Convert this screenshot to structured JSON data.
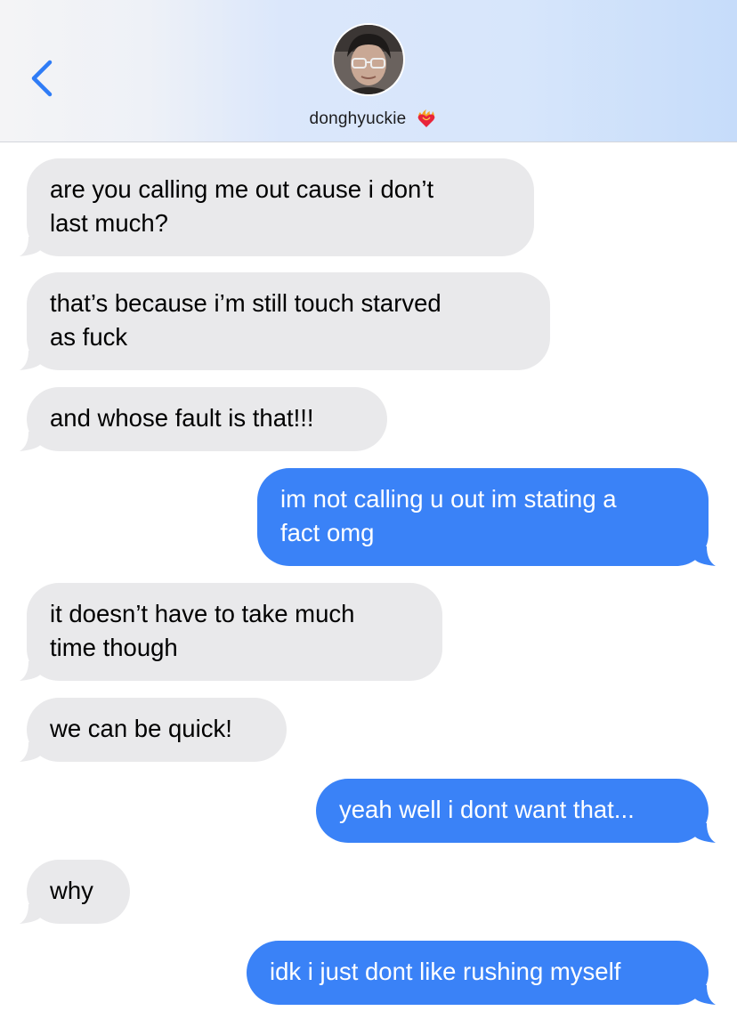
{
  "header": {
    "contact_name": "donghyuckie",
    "back_icon": "chevron-left-icon",
    "status_icon": "heart-on-fire-icon"
  },
  "colors": {
    "incoming_bubble": "#e9e9eb",
    "outgoing_bubble": "#3a82f7",
    "accent": "#2f7cf6"
  },
  "messages": [
    {
      "direction": "incoming",
      "lines": [
        "are you calling me out cause i don’t",
        "last much?"
      ]
    },
    {
      "direction": "incoming",
      "lines": [
        "that’s because i’m still touch starved",
        "as fuck"
      ]
    },
    {
      "direction": "incoming",
      "lines": [
        "and whose fault is that!!!"
      ]
    },
    {
      "direction": "outgoing",
      "lines": [
        "im not calling u out im stating a",
        "fact omg"
      ]
    },
    {
      "direction": "incoming",
      "lines": [
        "it doesn’t have to take much",
        "time though"
      ]
    },
    {
      "direction": "incoming",
      "lines": [
        "we can be quick!"
      ]
    },
    {
      "direction": "outgoing",
      "lines": [
        "yeah well i dont want that..."
      ]
    },
    {
      "direction": "incoming",
      "lines": [
        "why"
      ]
    },
    {
      "direction": "outgoing",
      "lines": [
        "idk i just dont like rushing myself"
      ]
    }
  ]
}
